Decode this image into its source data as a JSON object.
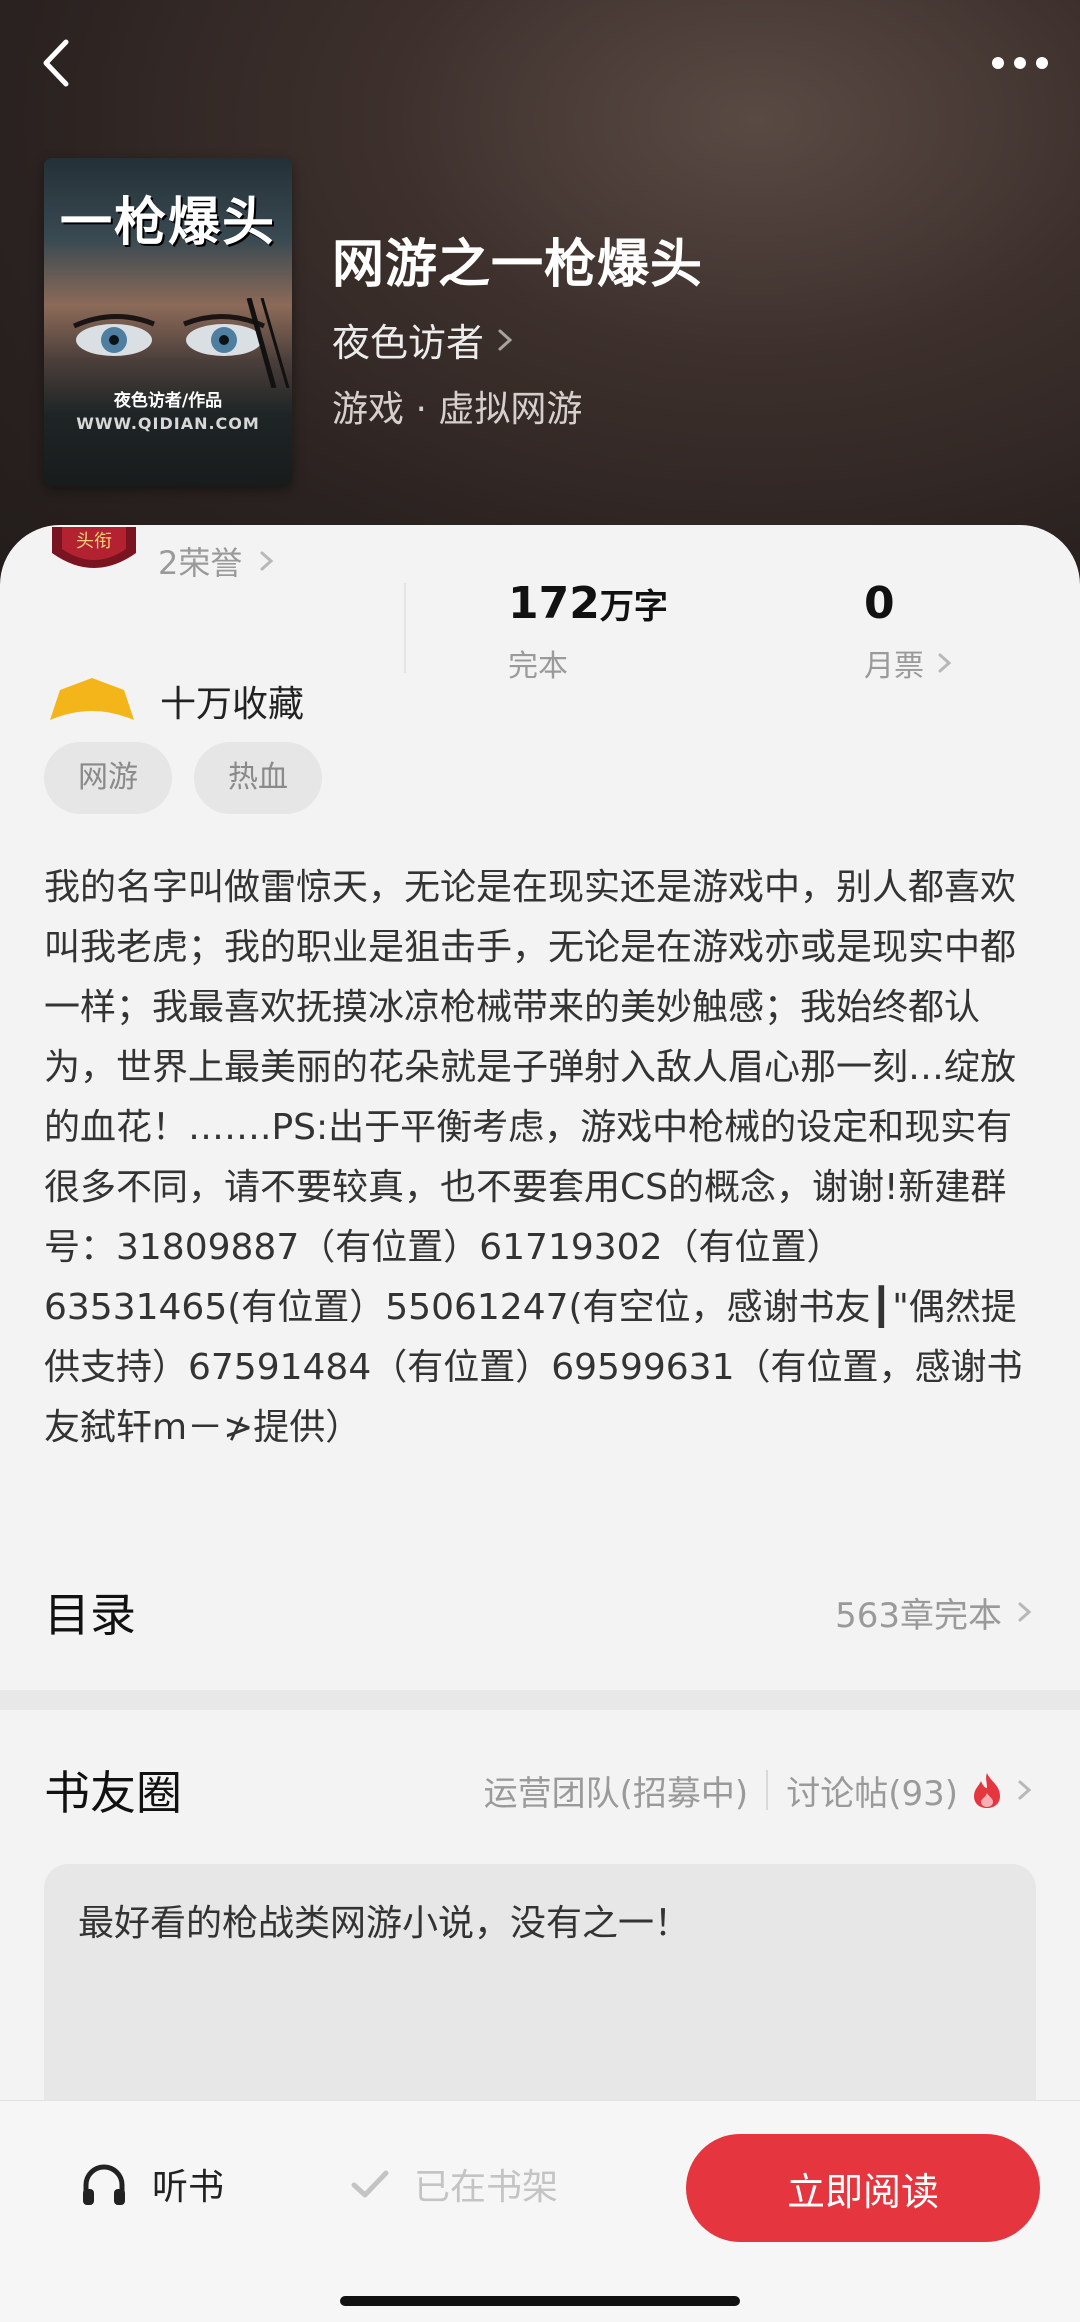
{
  "header": {
    "back_icon": "chevron-left-icon",
    "more_icon": "more-horizontal-icon",
    "cover": {
      "title": "一枪爆头",
      "author_line": "夜色访者/作品",
      "site": "WWW.QIDIAN.COM"
    },
    "book_title": "网游之一枪爆头",
    "author": "夜色访者",
    "genre": "游戏 · 虚拟网游"
  },
  "stats": {
    "honor_badge_text": "头衔",
    "honor": "2荣誉",
    "word_count_num": "172",
    "word_count_unit": "万字",
    "status": "完本",
    "monthly_votes": "0",
    "monthly_votes_label": "月票",
    "collect": "十万收藏"
  },
  "tags": [
    "网游",
    "热血"
  ],
  "description": "我的名字叫做雷惊天，无论是在现实还是游戏中，别人都喜欢叫我老虎；我的职业是狙击手，无论是在游戏亦或是现实中都一样；我最喜欢抚摸冰凉枪械带来的美妙触感；我始终都认为，世界上最美丽的花朵就是子弹射入敌人眉心那一刻…绽放的血花！…….PS:出于平衡考虑，游戏中枪械的设定和现实有很多不同，请不要较真，也不要套用CS的概念，谢谢!新建群号：31809887（有位置）61719302（有位置）63531465(有位置）55061247(有空位，感谢书友┃\"偶然提供支持）67591484（有位置）69599631（有位置，感谢书友弑轩m－≯提供）",
  "toc": {
    "title": "目录",
    "summary": "563章完本"
  },
  "circle": {
    "title": "书友圈",
    "ops_team": "运营团队(招募中)",
    "discussions": "讨论帖(93)",
    "post_text": "最好看的枪战类网游小说，没有之一！"
  },
  "bottom": {
    "listen": "听书",
    "shelf": "已在书架",
    "read": "立即阅读"
  },
  "colors": {
    "accent": "#e5353f",
    "header_bg": "#2a2220",
    "collect_icon": "#f3b519"
  }
}
